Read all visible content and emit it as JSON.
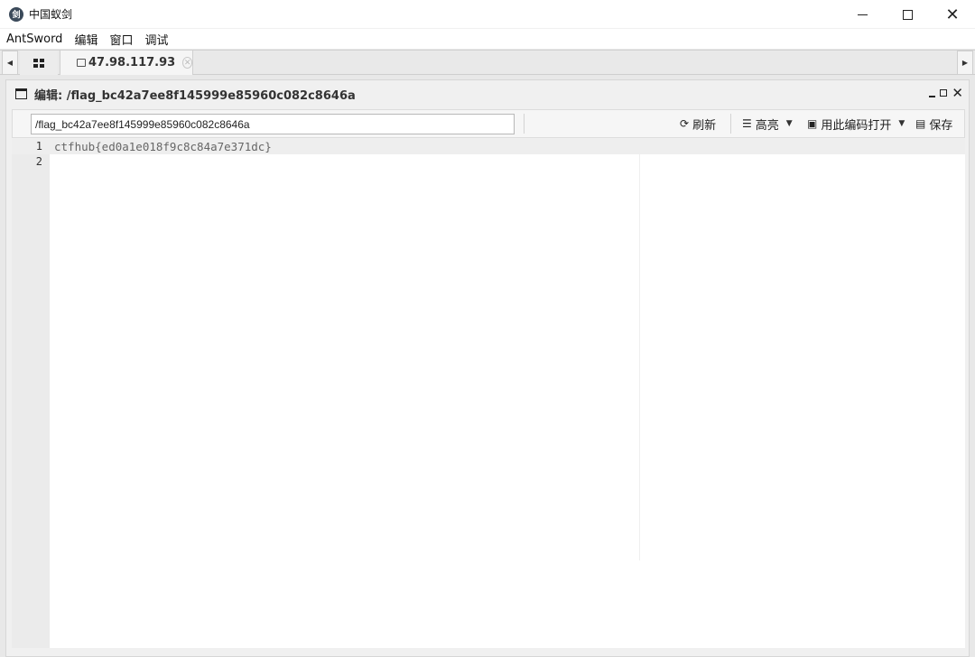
{
  "window": {
    "title": "中国蚁剑",
    "logo_text": "剑",
    "minimize": "",
    "maximize": "",
    "close": "✕"
  },
  "menu": {
    "items": [
      "AntSword",
      "编辑",
      "窗口",
      "调试"
    ]
  },
  "tabs": {
    "left_arrow": "◀",
    "right_arrow": "▶",
    "host_label": "47.98.117.93",
    "close_glyph": "✕"
  },
  "panel": {
    "title": "编辑: /flag_bc42a7ee8f145999e85960c082c8646a",
    "path_value": "/flag_bc42a7ee8f145999e85960c082c8646a",
    "refresh_label": "刷新",
    "highlight_label": "高亮",
    "open_with_encoding_label": "用此编码打开",
    "save_label": "保存",
    "icons": {
      "refresh": "refresh-icon",
      "highlight": "list-icon",
      "encoding": "encoding-icon",
      "save": "save-icon"
    }
  },
  "editor": {
    "lines": [
      {
        "number": "1",
        "text": "ctfhub{ed0a1e018f9c8c84a7e371dc}"
      },
      {
        "number": "2",
        "text": ""
      }
    ]
  }
}
